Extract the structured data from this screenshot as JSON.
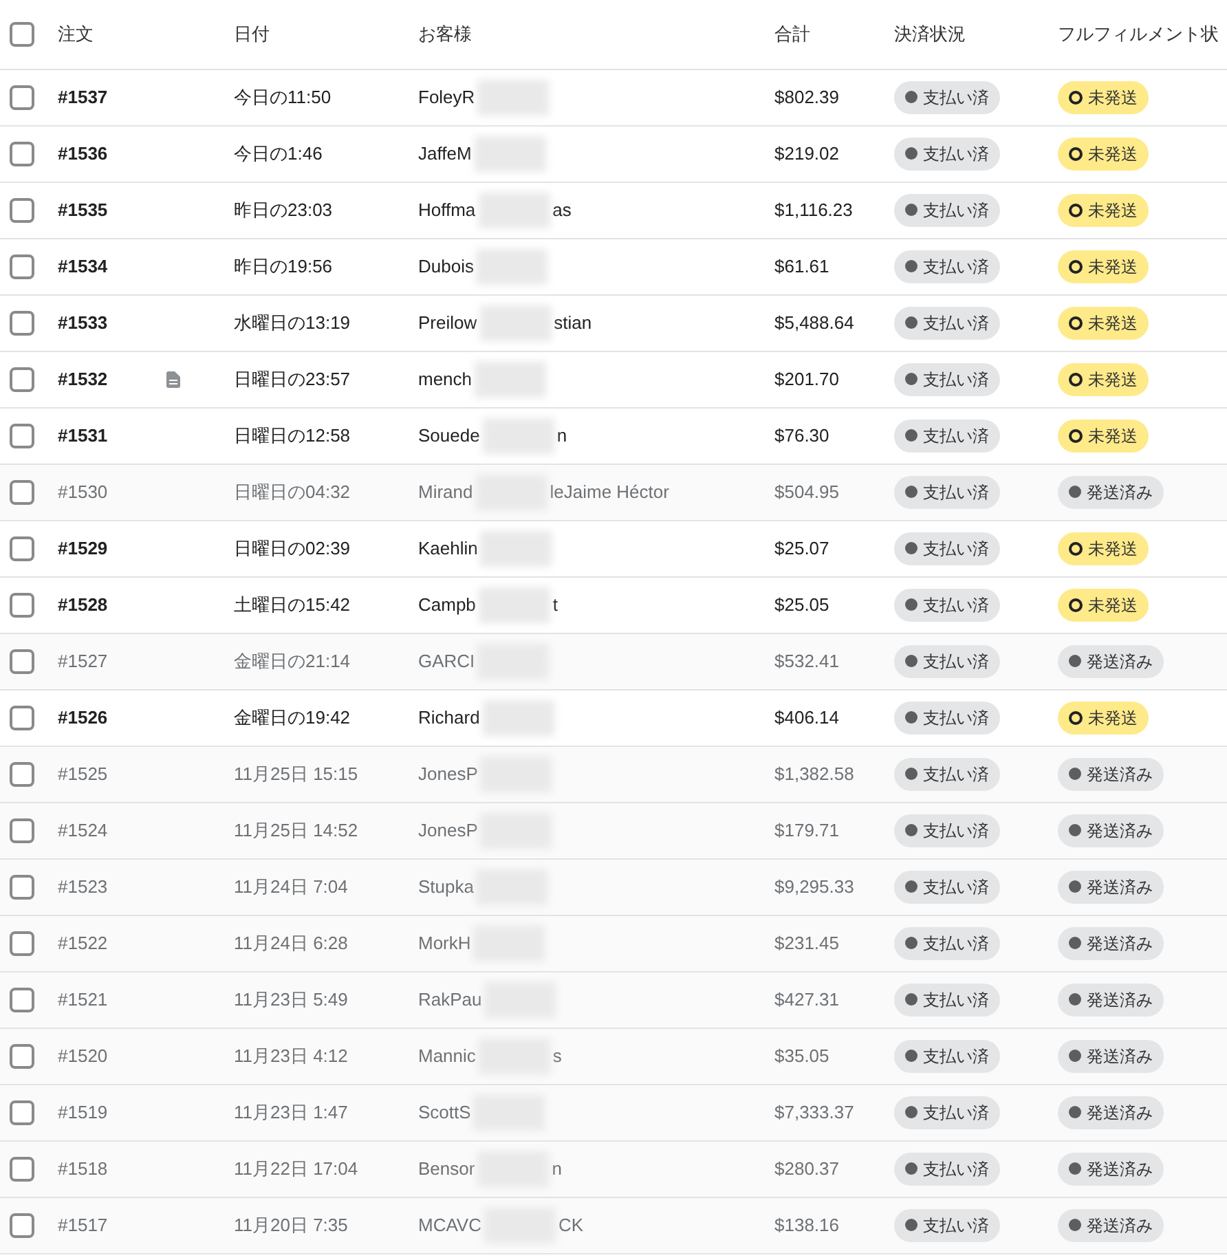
{
  "table": {
    "select_all": {
      "checked": false
    },
    "columns": [
      "注文",
      "日付",
      "お客様",
      "合計",
      "決済状況",
      "フルフィルメント状"
    ],
    "rows": [
      {
        "checked": false,
        "order": "#1537",
        "note": false,
        "date": "今日の11:50",
        "customer": {
          "first": "FoleyR"
        },
        "total": "$802.39",
        "payment": "支払い済",
        "fulfillment": {
          "kind": "unfulfilled",
          "label": "未発送"
        }
      },
      {
        "checked": false,
        "order": "#1536",
        "note": false,
        "date": "今日の1:46",
        "customer": {
          "first": "JaffeM"
        },
        "total": "$219.02",
        "payment": "支払い済",
        "fulfillment": {
          "kind": "unfulfilled",
          "label": "未発送"
        }
      },
      {
        "checked": false,
        "order": "#1535",
        "note": false,
        "date": "昨日の23:03",
        "customer": {
          "first": "Hoffma",
          "rest": "as"
        },
        "total": "$1,116.23",
        "payment": "支払い済",
        "fulfillment": {
          "kind": "unfulfilled",
          "label": "未発送"
        }
      },
      {
        "checked": false,
        "order": "#1534",
        "note": false,
        "date": "昨日の19:56",
        "customer": {
          "first": "Dubois"
        },
        "total": "$61.61",
        "payment": "支払い済",
        "fulfillment": {
          "kind": "unfulfilled",
          "label": "未発送"
        }
      },
      {
        "checked": false,
        "order": "#1533",
        "note": false,
        "date": "水曜日の13:19",
        "customer": {
          "first": "Preilow",
          "rest": "stian"
        },
        "total": "$5,488.64",
        "payment": "支払い済",
        "fulfillment": {
          "kind": "unfulfilled",
          "label": "未発送"
        }
      },
      {
        "checked": false,
        "order": "#1532",
        "note": true,
        "date": "日曜日の23:57",
        "customer": {
          "first": "mench"
        },
        "total": "$201.70",
        "payment": "支払い済",
        "fulfillment": {
          "kind": "unfulfilled",
          "label": "未発送"
        }
      },
      {
        "checked": false,
        "order": "#1531",
        "note": false,
        "date": "日曜日の12:58",
        "customer": {
          "first": "Souede",
          "rest": "n"
        },
        "total": "$76.30",
        "payment": "支払い済",
        "fulfillment": {
          "kind": "unfulfilled",
          "label": "未発送"
        }
      },
      {
        "checked": false,
        "order": "#1530",
        "note": false,
        "date": "日曜日の04:32",
        "customer": {
          "first": "Mirand",
          "rest": "leJaime Héctor"
        },
        "total": "$504.95",
        "payment": "支払い済",
        "fulfillment": {
          "kind": "fulfilled",
          "label": "発送済み"
        }
      },
      {
        "checked": false,
        "order": "#1529",
        "note": false,
        "date": "日曜日の02:39",
        "customer": {
          "first": "Kaehlin"
        },
        "total": "$25.07",
        "payment": "支払い済",
        "fulfillment": {
          "kind": "unfulfilled",
          "label": "未発送"
        }
      },
      {
        "checked": false,
        "order": "#1528",
        "note": false,
        "date": "土曜日の15:42",
        "customer": {
          "first": "Campb",
          "rest": "t"
        },
        "total": "$25.05",
        "payment": "支払い済",
        "fulfillment": {
          "kind": "unfulfilled",
          "label": "未発送"
        }
      },
      {
        "checked": false,
        "order": "#1527",
        "note": false,
        "date": "金曜日の21:14",
        "customer": {
          "first": "GARCI"
        },
        "total": "$532.41",
        "payment": "支払い済",
        "fulfillment": {
          "kind": "fulfilled",
          "label": "発送済み"
        }
      },
      {
        "checked": false,
        "order": "#1526",
        "note": false,
        "date": "金曜日の19:42",
        "customer": {
          "first": "Richard"
        },
        "total": "$406.14",
        "payment": "支払い済",
        "fulfillment": {
          "kind": "unfulfilled",
          "label": "未発送"
        }
      },
      {
        "checked": false,
        "order": "#1525",
        "note": false,
        "date": "11月25日 15:15",
        "customer": {
          "first": "JonesP"
        },
        "total": "$1,382.58",
        "payment": "支払い済",
        "fulfillment": {
          "kind": "fulfilled",
          "label": "発送済み"
        }
      },
      {
        "checked": false,
        "order": "#1524",
        "note": false,
        "date": "11月25日 14:52",
        "customer": {
          "first": "JonesP"
        },
        "total": "$179.71",
        "payment": "支払い済",
        "fulfillment": {
          "kind": "fulfilled",
          "label": "発送済み"
        }
      },
      {
        "checked": false,
        "order": "#1523",
        "note": false,
        "date": "11月24日 7:04",
        "customer": {
          "first": "Stupka"
        },
        "total": "$9,295.33",
        "payment": "支払い済",
        "fulfillment": {
          "kind": "fulfilled",
          "label": "発送済み"
        }
      },
      {
        "checked": false,
        "order": "#1522",
        "note": false,
        "date": "11月24日 6:28",
        "customer": {
          "first": "MorkH"
        },
        "total": "$231.45",
        "payment": "支払い済",
        "fulfillment": {
          "kind": "fulfilled",
          "label": "発送済み"
        }
      },
      {
        "checked": false,
        "order": "#1521",
        "note": false,
        "date": "11月23日 5:49",
        "customer": {
          "first": "RakPau"
        },
        "total": "$427.31",
        "payment": "支払い済",
        "fulfillment": {
          "kind": "fulfilled",
          "label": "発送済み"
        }
      },
      {
        "checked": false,
        "order": "#1520",
        "note": false,
        "date": "11月23日 4:12",
        "customer": {
          "first": "Mannic",
          "rest": "s"
        },
        "total": "$35.05",
        "payment": "支払い済",
        "fulfillment": {
          "kind": "fulfilled",
          "label": "発送済み"
        }
      },
      {
        "checked": false,
        "order": "#1519",
        "note": false,
        "date": "11月23日 1:47",
        "customer": {
          "first": "ScottS"
        },
        "total": "$7,333.37",
        "payment": "支払い済",
        "fulfillment": {
          "kind": "fulfilled",
          "label": "発送済み"
        }
      },
      {
        "checked": false,
        "order": "#1518",
        "note": false,
        "date": "11月22日 17:04",
        "customer": {
          "first": "Bensor",
          "rest": "n"
        },
        "total": "$280.37",
        "payment": "支払い済",
        "fulfillment": {
          "kind": "fulfilled",
          "label": "発送済み"
        }
      },
      {
        "checked": false,
        "order": "#1517",
        "note": false,
        "date": "11月20日 7:35",
        "customer": {
          "first": "MCAVC",
          "rest": "CK"
        },
        "total": "$138.16",
        "payment": "支払い済",
        "fulfillment": {
          "kind": "fulfilled",
          "label": "発送済み"
        }
      }
    ]
  }
}
